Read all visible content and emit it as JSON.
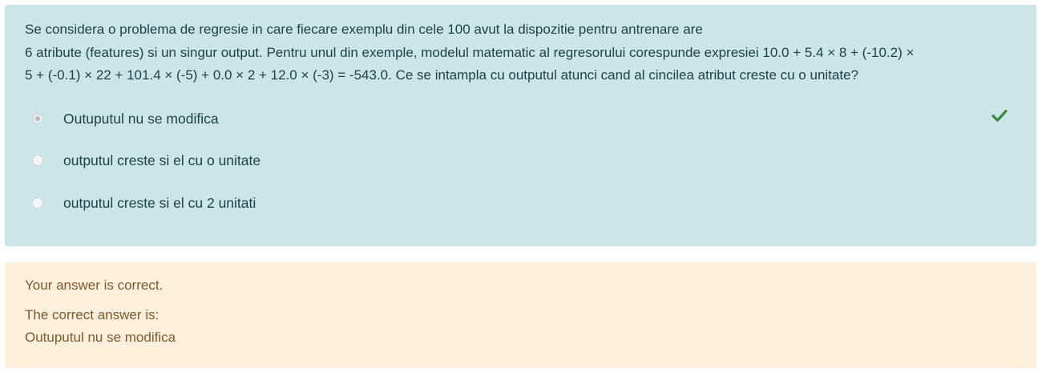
{
  "question": {
    "lines": [
      "Se considera o problema de regresie in care fiecare exemplu din cele 100 avut la dispozitie pentru antrenare are",
      "6 atribute (features) si un singur output. Pentru unul din exemple, modelul matematic al regresorului corespunde expresiei 10.0 + 5.4 × 8 + (-10.2) ×",
      "5 + (-0.1) × 22 + 101.4 × (-5) + 0.0 × 2 + 12.0 × (-3) = -543.0. Ce se intampla cu outputul atunci cand al cincilea atribut creste cu o unitate?"
    ]
  },
  "answers": [
    {
      "label": "Outuputul nu se modifica",
      "selected": true,
      "correct": true
    },
    {
      "label": "outputul creste si el cu o unitate",
      "selected": false
    },
    {
      "label": "outputul creste si el cu 2 unitati",
      "selected": false
    }
  ],
  "feedback": {
    "result": "Your answer is correct.",
    "correct_answer_heading": "The correct answer is:",
    "correct_answer": "Outuputul nu se modifica"
  },
  "colors": {
    "question_bg": "#cce5e9",
    "feedback_bg": "#fcefdc",
    "check_green": "#3a8a3a"
  },
  "icons": {
    "correct_mark": "check-icon"
  }
}
